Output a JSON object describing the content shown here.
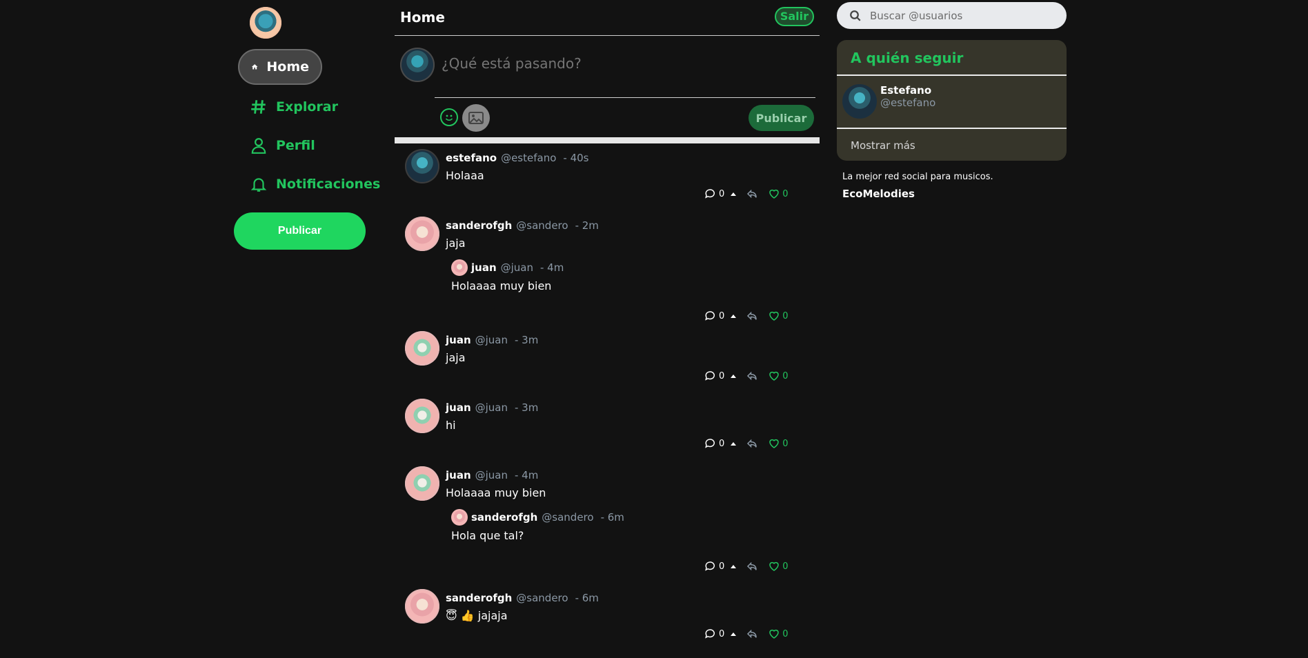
{
  "sidebar": {
    "items": [
      {
        "label": "Home",
        "icon": "home-icon"
      },
      {
        "label": "Explorar",
        "icon": "hash-icon"
      },
      {
        "label": "Perfil",
        "icon": "user-icon"
      },
      {
        "label": "Notificaciones",
        "icon": "bell-icon"
      }
    ],
    "publish_label": "Publicar"
  },
  "header": {
    "title": "Home",
    "logout_label": "Salir"
  },
  "composer": {
    "placeholder": "¿Qué está pasando?",
    "publish_label": "Publicar"
  },
  "feed": [
    {
      "name": "estefano",
      "handle": "@estefano",
      "time": "-  40s",
      "text": "Holaaa",
      "replies": "0",
      "likes": "0"
    },
    {
      "name": "sanderofgh",
      "handle": "@sandero",
      "time": "-  2m",
      "text": "jaja",
      "quote": {
        "name": "juan",
        "handle": "@juan",
        "time": "-  4m",
        "text": "Holaaaa muy bien"
      },
      "replies": "0",
      "likes": "0"
    },
    {
      "name": "juan",
      "handle": "@juan",
      "time": "-  3m",
      "text": "jaja",
      "replies": "0",
      "likes": "0"
    },
    {
      "name": "juan",
      "handle": "@juan",
      "time": "-  3m",
      "text": "hi",
      "replies": "0",
      "likes": "0"
    },
    {
      "name": "juan",
      "handle": "@juan",
      "time": "-  4m",
      "text": "Holaaaa muy bien",
      "quote": {
        "name": "sanderofgh",
        "handle": "@sandero",
        "time": "-  6m",
        "text": "Hola que tal?"
      },
      "replies": "0",
      "likes": "0"
    },
    {
      "name": "sanderofgh",
      "handle": "@sandero",
      "time": "-  6m",
      "text": "😇 👍 jajaja",
      "replies": "0",
      "likes": "0"
    }
  ],
  "search": {
    "placeholder": "Buscar @usuarios"
  },
  "who_to_follow": {
    "title": "A quién seguir",
    "users": [
      {
        "name": "Estefano",
        "handle": "@estefano"
      }
    ],
    "more_label": "Mostrar más"
  },
  "footer": {
    "tagline": "La mejor red social para musicos.",
    "brand": "EcoMelodies"
  },
  "colors": {
    "accent": "#22c55e",
    "background": "#121212",
    "panel": "#36352a"
  }
}
